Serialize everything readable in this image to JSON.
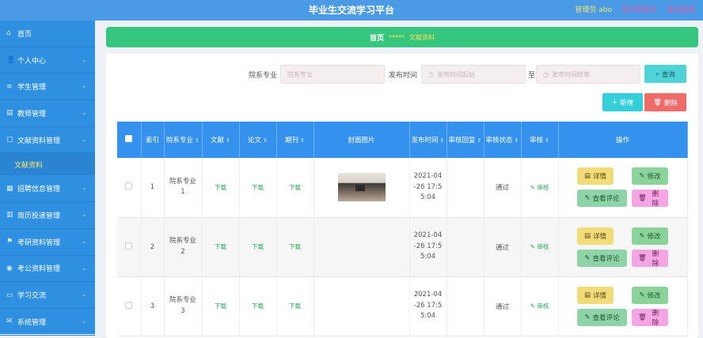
{
  "header": {
    "title": "毕业生交流学习平台",
    "admin": "管理员 abo",
    "link1": "退出到前台",
    "link2": "退出登录"
  },
  "sidebar": {
    "items": [
      {
        "label": "首页",
        "icon": "home-icon",
        "glyph": "⌂",
        "chevron": false
      },
      {
        "label": "个人中心",
        "icon": "user-icon",
        "glyph": "👤",
        "chevron": true
      },
      {
        "label": "学生管理",
        "icon": "list-icon",
        "glyph": "≡",
        "chevron": true
      },
      {
        "label": "教师管理",
        "icon": "doc-icon",
        "glyph": "▤",
        "chevron": true
      },
      {
        "label": "文献资料管理",
        "icon": "book-icon",
        "glyph": "▢",
        "chevron": true
      },
      {
        "label": "招聘信息管理",
        "icon": "grid-icon",
        "glyph": "▦",
        "chevron": true
      },
      {
        "label": "简历投递管理",
        "icon": "chart-icon",
        "glyph": "▥",
        "chevron": true
      },
      {
        "label": "考研资料管理",
        "icon": "flag-icon",
        "glyph": "⚑",
        "chevron": true
      },
      {
        "label": "考公资料管理",
        "icon": "chat-icon",
        "glyph": "◉",
        "chevron": true
      },
      {
        "label": "学习交流",
        "icon": "message-icon",
        "glyph": "▭",
        "chevron": true
      },
      {
        "label": "系统管理",
        "icon": "mail-icon",
        "glyph": "✉",
        "chevron": true
      }
    ],
    "sub_item": "文献资料"
  },
  "breadcrumb": {
    "home": "首页",
    "sep": "*****",
    "current": "文献资料"
  },
  "filter": {
    "major_label": "院系专业",
    "major_placeholder": "院系专业",
    "time_label": "发布时间",
    "start_placeholder": "发布时间起始",
    "to_label": "至",
    "end_placeholder": "发布时间结束",
    "search_label": "查询"
  },
  "actions": {
    "add_label": "新增",
    "delete_label": "删除"
  },
  "table": {
    "headers": [
      "",
      "索引",
      "院系专业",
      "文献",
      "论文",
      "期刊",
      "封面图片",
      "发布时间",
      "审核回复",
      "审核状态",
      "审核",
      "操作"
    ],
    "rows": [
      {
        "index": "1",
        "major": "院系专业\n1",
        "wenxian": "下载",
        "lunwen": "下载",
        "qikan": "下载",
        "has_cover": true,
        "time": "2021-04\n-26 17:5\n5:04",
        "reply": "",
        "status": "通过",
        "audit": "审核"
      },
      {
        "index": "2",
        "major": "院系专业\n2",
        "wenxian": "下载",
        "lunwen": "下载",
        "qikan": "下载",
        "has_cover": false,
        "time": "2021-04\n-26 17:5\n5:04",
        "reply": "",
        "status": "通过",
        "audit": "审核"
      },
      {
        "index": "3",
        "major": "院系专业\n3",
        "wenxian": "下载",
        "lunwen": "下载",
        "qikan": "下载",
        "has_cover": false,
        "time": "2021-04\n-26 17:5\n5:04",
        "reply": "",
        "status": "通过",
        "audit": "审核"
      }
    ],
    "ops": {
      "detail": "详情",
      "edit": "修改",
      "comment": "查看评论",
      "delete": "删除"
    }
  },
  "colors": {
    "topbar": "#4a9ae6",
    "sidebar": "#2f8fe0",
    "breadcrumb": "#36c77f",
    "table_header": "#3591ee"
  }
}
